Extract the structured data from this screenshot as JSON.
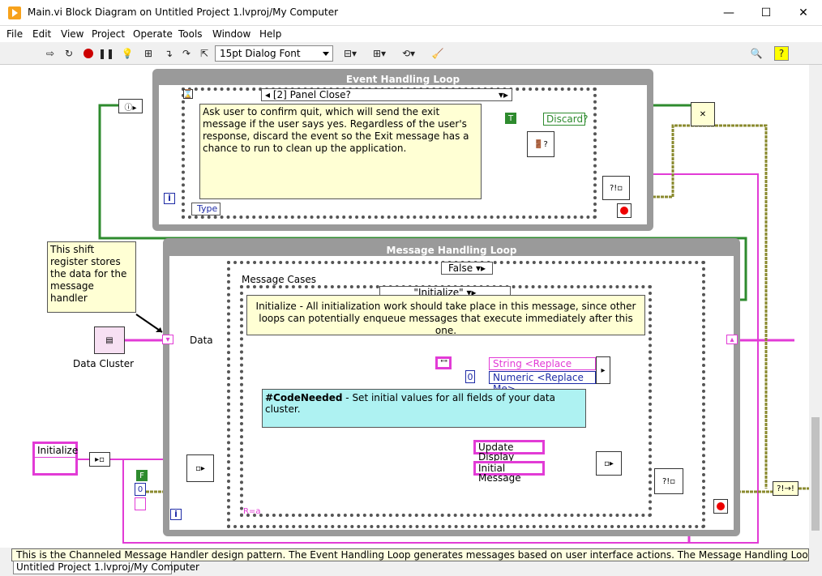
{
  "window": {
    "title": "Main.vi Block Diagram on Untitled Project 1.lvproj/My Computer",
    "minimize": "—",
    "maximize": "☐",
    "close": "✕"
  },
  "menu": [
    "File",
    "Edit",
    "View",
    "Project",
    "Operate",
    "Tools",
    "Window",
    "Help"
  ],
  "toolbar": {
    "font": "15pt Dialog Font"
  },
  "event_loop": {
    "title": "Event Handling Loop",
    "case_selector": "[2] Panel Close?",
    "comment": "Ask user to confirm quit, which will send the exit message if the user says yes. Regardless of the user's response, discard the event so the Exit message has a chance to run to clean up the application.",
    "type_label": "Type",
    "discard_label": "Discard?",
    "bool_const": "T"
  },
  "shift_register_note": "This shift register stores the data for the message handler",
  "data_cluster_label": "Data Cluster",
  "data_label": "Data",
  "message_loop": {
    "title": "Message Handling Loop",
    "outer_case": "False",
    "message_cases_label": "Message Cases",
    "inner_case": "\"Initialize\"",
    "init_comment": "Initialize - All initialization work should take place in this message, since other loops can potentially enqueue messages that execute immediately after this one.",
    "code_needed_bold": "#CodeNeeded",
    "code_needed_rest": " - Set initial values for all fields of your data cluster.",
    "string_replace": "String <Replace Me>",
    "numeric_replace": "Numeric <Replace Me>",
    "numeric_const": "0",
    "update_display": "Update Display",
    "initial_message": "Initial Message",
    "empty_string": "\"\"",
    "bool_f": "F",
    "f_zero": "0"
  },
  "initialize_const": "Initialize",
  "bottom_comment": "This is the Channeled Message Handler design pattern. The Event Handling Loop generates messages based on user interface actions. The Message Handling Loop processes messages",
  "project_path": "Untitled Project 1.lvproj/My Computer"
}
